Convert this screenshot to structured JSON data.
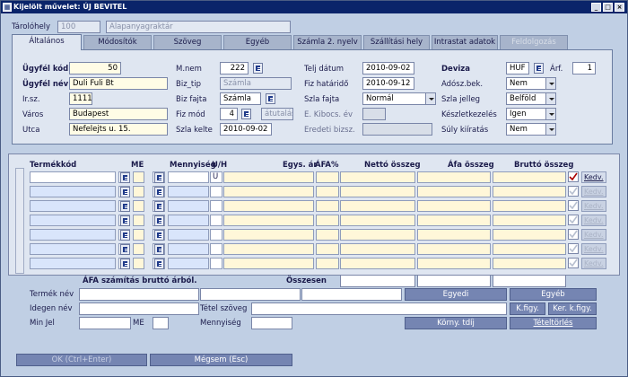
{
  "window": {
    "title": "Kijelölt művelet: ÚJ BEVITEL",
    "icon": "app-icon"
  },
  "header": {
    "store_label": "Tárolóhely",
    "store_code": "100",
    "store_name": "Alapanyagraktár"
  },
  "tabs": [
    "Általános",
    "Módosítók",
    "Szöveg",
    "Egyéb",
    "Számla 2. nyelv",
    "Szállítási hely",
    "Intrastat adatok",
    "Feldolgozás"
  ],
  "general": {
    "customer_code_label": "Ügyfél kód",
    "customer_code": "50",
    "customer_name_label": "Ügyfél név",
    "customer_name": "Duli Fuli Bt",
    "zip_label": "Ir.sz.",
    "zip": "1111",
    "city_label": "Város",
    "city": "Budapest",
    "street_label": "Utca",
    "street": "Nefelejts u. 15.",
    "mnem_label": "M.nem",
    "mnem": "222",
    "biztip_label": "Biz_tip",
    "biztip": "Számla",
    "bizfajta_label": "Biz fajta",
    "bizfajta": "Számla",
    "fizmod_label": "Fiz mód",
    "fizmod": "4",
    "fizmod_name": "átutalás",
    "szlakelte_label": "Szla kelte",
    "szlakelte": "2010-09-02",
    "teljdatum_label": "Telj dátum",
    "teljdatum": "2010-09-02",
    "fizhatarido_label": "Fiz határidő",
    "fizhatarido": "2010-09-12",
    "szlafajta_label": "Szla fajta",
    "szlafajta": "Normál",
    "ekibocs_label": "E. Kibocs. év",
    "eredeti_label": "Eredeti bizsz.",
    "deviza_label": "Deviza",
    "deviza": "HUF",
    "arf_label": "Árf.",
    "arf": "1",
    "adosz_label": "Adósz.bek.",
    "adosz": "Nem",
    "szlajelleg_label": "Szla jelleg",
    "szlajelleg": "Belföld",
    "keszlet_label": "Készletkezelés",
    "keszlet": "Igen",
    "suly_label": "Súly kiíratás",
    "suly": "Nem"
  },
  "grid": {
    "columns": [
      "Termékkód",
      "ME",
      "Mennyiség",
      "U/H",
      "Egys. ár",
      "ÁFA%",
      "Nettó összeg",
      "Áfa összeg",
      "Bruttó összeg"
    ],
    "first_row_uh": "U",
    "kedv_label": "Kedv."
  },
  "bottom": {
    "afa_calc_label": "ÁFA számítás bruttó árból.",
    "osszesen_label": "Összesen",
    "termeknev_label": "Termék név",
    "idegennev_label": "Idegen név",
    "tetelszoveg_label": "Tétel szöveg",
    "minjel_label": "Min Jel",
    "me_label": "ME",
    "mennyiseg_label": "Mennyiség",
    "egyedi_btn": "Egyedi",
    "egyeb_btn": "Egyéb",
    "kfigy_btn": "K.figy.",
    "kerkfigy_btn": "Ker. k.figy.",
    "kornytdij_btn": "Körny. tdíj",
    "teteltorles_btn": "Tételtörlés"
  },
  "footer": {
    "ok_btn": "OK (Ctrl+Enter)",
    "cancel_btn": "Mégsem (Esc)"
  }
}
